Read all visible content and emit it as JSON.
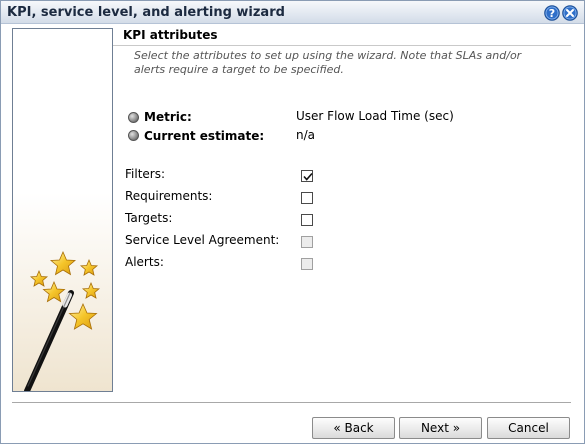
{
  "window": {
    "title": "KPI, service level, and alerting wizard",
    "help_icon": "help-icon",
    "close_icon": "close-icon"
  },
  "section": {
    "title": "KPI attributes",
    "description": "Select the attributes to set up using the wizard. Note that SLAs and/or alerts require a target to be specified."
  },
  "info": {
    "metric_label": "Metric:",
    "metric_value": "User Flow Load Time (sec)",
    "estimate_label": "Current estimate:",
    "estimate_value": "n/a"
  },
  "attributes": [
    {
      "label": "Filters:",
      "checked": true,
      "enabled": true
    },
    {
      "label": "Requirements:",
      "checked": false,
      "enabled": true
    },
    {
      "label": "Targets:",
      "checked": false,
      "enabled": true
    },
    {
      "label": "Service Level Agreement:",
      "checked": false,
      "enabled": false
    },
    {
      "label": "Alerts:",
      "checked": false,
      "enabled": false
    }
  ],
  "buttons": {
    "back": "« Back",
    "next": "Next »",
    "cancel": "Cancel"
  },
  "colors": {
    "star": "#f2c12e",
    "wand": "#1a1a1a"
  }
}
